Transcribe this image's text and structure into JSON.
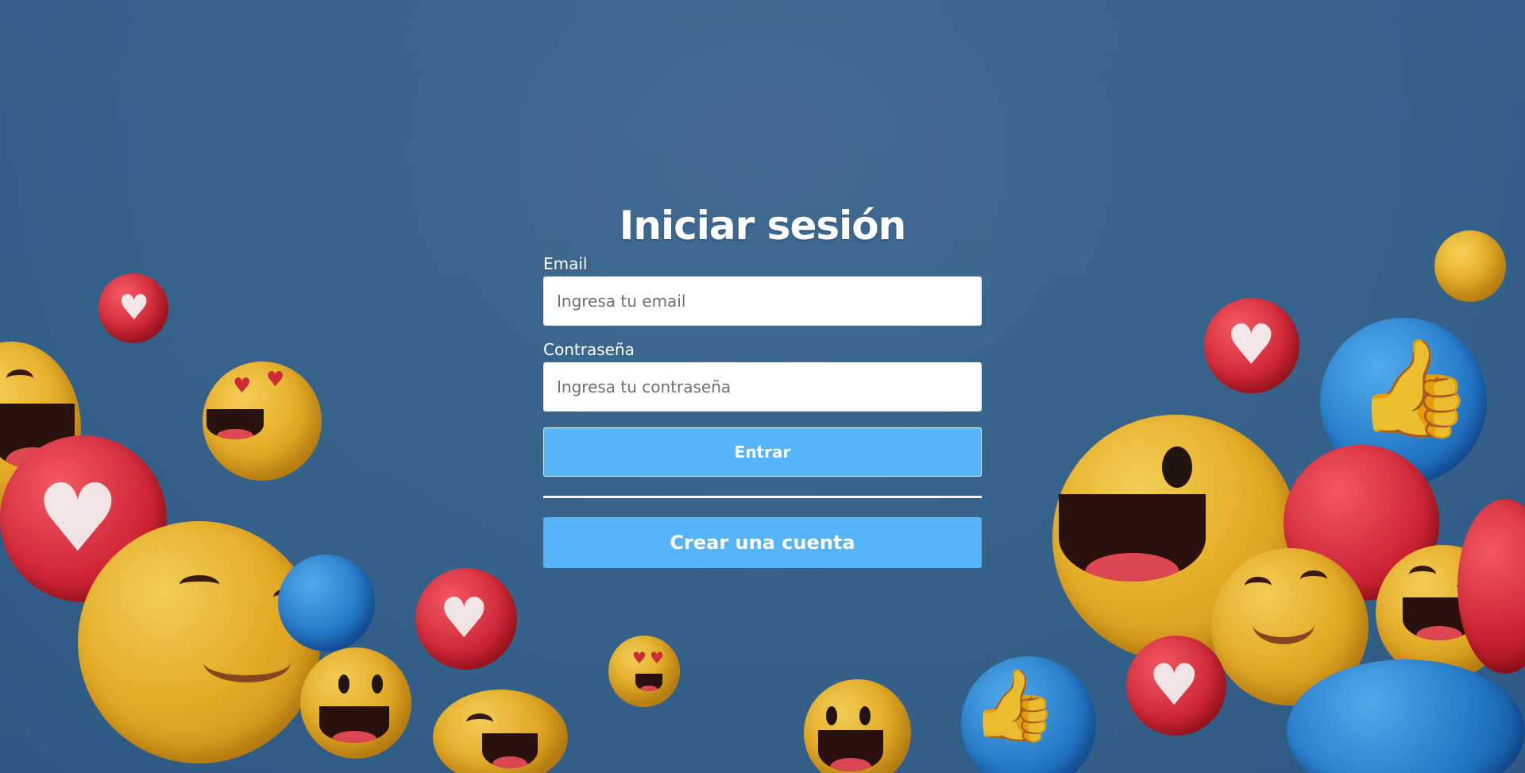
{
  "page": {
    "title": "Iniciar sesión"
  },
  "form": {
    "email_label": "Email",
    "email_placeholder": "Ingresa tu email",
    "password_label": "Contraseña",
    "password_placeholder": "Ingresa tu contraseña",
    "submit_label": "Entrar",
    "create_account_label": "Crear una cuenta"
  },
  "theme": {
    "background": "#3a6892",
    "button_color": "#55b4f7",
    "text_color": "#ffffff"
  },
  "decorations": {
    "icons": [
      "smiley-icon",
      "heart-eyes-icon",
      "heart-icon",
      "thumbs-up-icon"
    ]
  }
}
